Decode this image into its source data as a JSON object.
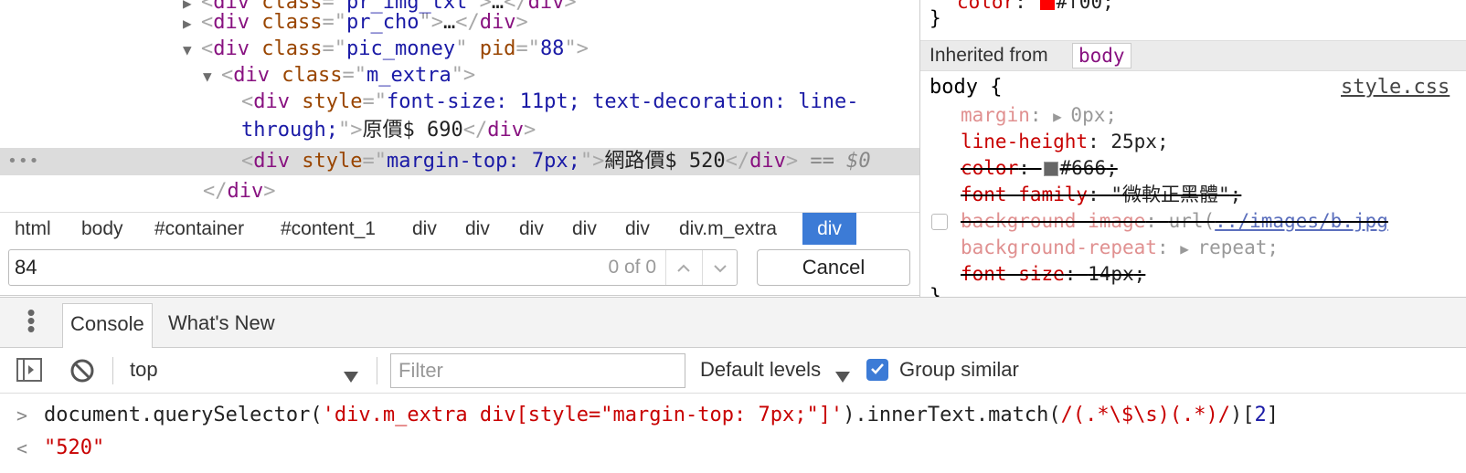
{
  "elements": {
    "lines": [
      {
        "indent": 1,
        "arrow": "▶",
        "html": [
          [
            "br",
            "<"
          ],
          [
            "tag",
            "div "
          ],
          [
            "an",
            "class"
          ],
          [
            "br",
            "=\""
          ],
          [
            "av",
            "pr_img_txt"
          ],
          [
            "br",
            "\">"
          ],
          [
            "txt",
            "…"
          ],
          [
            "br",
            "</"
          ],
          [
            "tag",
            "div"
          ],
          [
            "br",
            ">"
          ]
        ]
      },
      {
        "indent": 1,
        "arrow": "▶",
        "html": [
          [
            "br",
            "<"
          ],
          [
            "tag",
            "div "
          ],
          [
            "an",
            "class"
          ],
          [
            "br",
            "=\""
          ],
          [
            "av",
            "pr_cho"
          ],
          [
            "br",
            "\">"
          ],
          [
            "txt",
            "…"
          ],
          [
            "br",
            "</"
          ],
          [
            "tag",
            "div"
          ],
          [
            "br",
            ">"
          ]
        ]
      },
      {
        "indent": 1,
        "arrow": "▼",
        "html": [
          [
            "br",
            "<"
          ],
          [
            "tag",
            "div "
          ],
          [
            "an",
            "class"
          ],
          [
            "br",
            "=\""
          ],
          [
            "av",
            "pic_money"
          ],
          [
            "br",
            "\" "
          ],
          [
            "an",
            "pid"
          ],
          [
            "br",
            "=\""
          ],
          [
            "av",
            "88"
          ],
          [
            "br",
            "\">"
          ]
        ]
      },
      {
        "indent": 2,
        "arrow": "▼",
        "html": [
          [
            "br",
            "<"
          ],
          [
            "tag",
            "div "
          ],
          [
            "an",
            "class"
          ],
          [
            "br",
            "=\""
          ],
          [
            "av",
            "m_extra"
          ],
          [
            "br",
            "\">"
          ]
        ]
      },
      {
        "indent": 3,
        "arrow": "",
        "html": [
          [
            "br",
            "<"
          ],
          [
            "tag",
            "div "
          ],
          [
            "an",
            "style"
          ],
          [
            "br",
            "=\""
          ],
          [
            "av",
            "font-size: 11pt; text-decoration: line-"
          ]
        ]
      },
      {
        "indent": 3,
        "arrow": "",
        "html": [
          [
            "av",
            "through;"
          ],
          [
            "br",
            "\">"
          ],
          [
            "txt",
            "原價$ 690"
          ],
          [
            "br",
            "</"
          ],
          [
            "tag",
            "div"
          ],
          [
            "br",
            ">"
          ]
        ]
      },
      {
        "indent": 3,
        "arrow": "",
        "selected": true,
        "html": [
          [
            "br",
            "<"
          ],
          [
            "tag",
            "div "
          ],
          [
            "an",
            "style"
          ],
          [
            "br",
            "=\""
          ],
          [
            "av",
            "margin-top: 7px;"
          ],
          [
            "br",
            "\">"
          ],
          [
            "txt",
            "網路價$ 520"
          ],
          [
            "br",
            "</"
          ],
          [
            "tag",
            "div"
          ],
          [
            "br",
            "> "
          ],
          [
            "eq",
            "== "
          ],
          [
            "dollar",
            "$0"
          ]
        ]
      },
      {
        "indent": 2,
        "arrow": "",
        "html": [
          [
            "br",
            "</"
          ],
          [
            "tag",
            "div"
          ],
          [
            "br",
            ">"
          ]
        ]
      }
    ],
    "dots": "•••"
  },
  "breadcrumbs": [
    "html",
    "body",
    "#container",
    "#content_1",
    "div",
    "div",
    "div",
    "div",
    "div",
    "div.m_extra",
    "div"
  ],
  "search": {
    "value": "84",
    "count": "0 of 0",
    "cancel": "Cancel",
    "up": "⌃",
    "down": "⌄"
  },
  "styles": {
    "prev_close": "}",
    "prev_color_prop": "color",
    "prev_color_val": "#f00",
    "inherited_label": "Inherited from",
    "inherited_tag": "body",
    "selector": "body {",
    "source": "style.css",
    "close": "}",
    "rules": [
      {
        "prop": "margin",
        "val": "0px",
        "faded": true,
        "strike": false,
        "arrow": true
      },
      {
        "prop": "line-height",
        "val": "25px",
        "faded": false,
        "strike": false
      },
      {
        "prop": "color",
        "val": "#666",
        "faded": false,
        "strike": true,
        "swatch": "#666666"
      },
      {
        "prop": "font-family",
        "val": "\"微軟正黑體\"",
        "faded": false,
        "strike": true
      },
      {
        "prop": "background-image",
        "val_pre": "url(",
        "val_link": "../images/b.jpg",
        "faded": true,
        "strike": true,
        "checkbox": true
      },
      {
        "prop": "background-repeat",
        "val": "repeat",
        "faded": true,
        "strike": false,
        "arrow": true
      },
      {
        "prop": "font-size",
        "val": "14px",
        "faded": false,
        "strike": true
      }
    ]
  },
  "drawer": {
    "tabs": [
      "Console",
      "What's New"
    ],
    "toolbar": {
      "context": "top",
      "filter_placeholder": "Filter",
      "levels": "Default levels",
      "group_similar": "Group similar"
    },
    "console": {
      "input_parts": [
        [
          "code",
          "document.querySelector("
        ],
        [
          "str",
          "'div.m_extra div[style=\"margin-top: 7px;\"]'"
        ],
        [
          "code",
          ").innerText.match("
        ],
        [
          "rgx",
          "/(.*\\$\\s)(.*)/"
        ],
        [
          "code",
          ")["
        ],
        [
          "num",
          "2"
        ],
        [
          "code",
          "]"
        ]
      ],
      "result": "\"520\""
    }
  },
  "colors": {
    "accent": "#3c7bd6",
    "tag": "#881280",
    "attr_name": "#994500",
    "attr_value": "#1a1aa6",
    "css_prop": "#c80000"
  }
}
